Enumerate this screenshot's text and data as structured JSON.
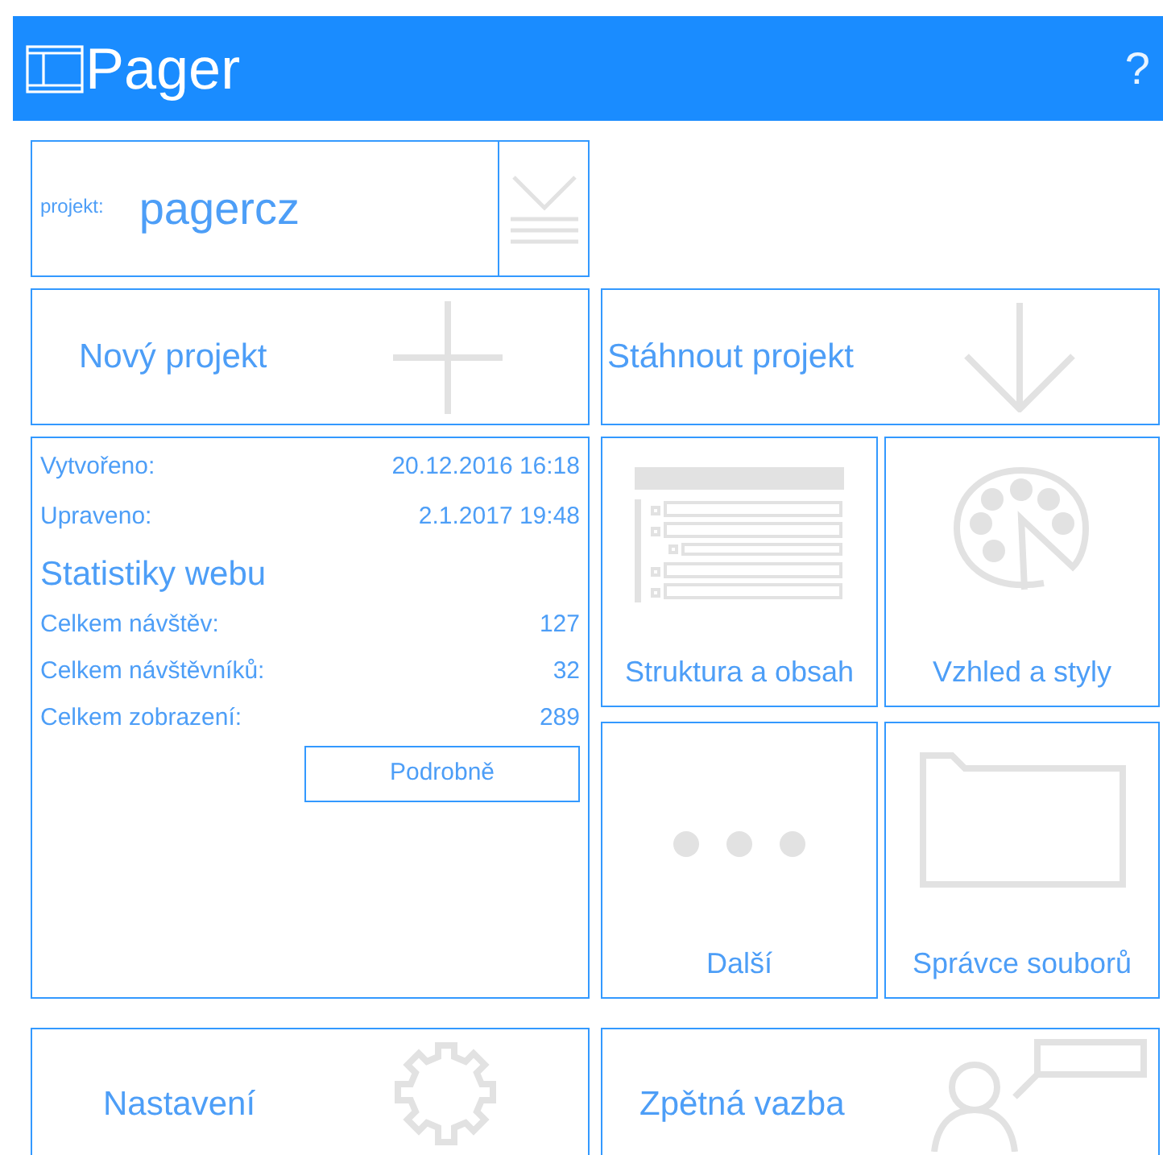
{
  "header": {
    "title": "Pager",
    "help": "?"
  },
  "project": {
    "label": "projekt:",
    "name": "pagercz"
  },
  "actions": [
    {
      "label": "Nový projekt",
      "kind": "plus"
    },
    {
      "label": "Stáhnout projekt",
      "kind": "download"
    }
  ],
  "info": {
    "rows": [
      {
        "label": "Vytvořeno:",
        "value": "20.12.2016 16:18"
      },
      {
        "label": "Upraveno:",
        "value": "2.1.2017 19:48"
      }
    ],
    "stats_title": "Statistiky webu",
    "stats": [
      {
        "label": "Celkem návštěv:",
        "value": "127"
      },
      {
        "label": "Celkem návštěvníků:",
        "value": "32"
      },
      {
        "label": "Celkem zobrazení:",
        "value": "289"
      }
    ],
    "button": "Podrobně"
  },
  "tiles": [
    {
      "label": "Struktura a obsah",
      "kind": "structure"
    },
    {
      "label": "Vzhled a styly",
      "kind": "palette"
    },
    {
      "label": "Další",
      "kind": "more"
    },
    {
      "label": "Správce souborů",
      "kind": "folder"
    }
  ],
  "bottom": [
    {
      "label": "Nastavení",
      "kind": "gear"
    },
    {
      "label": "Zpětná vazba",
      "kind": "feedback"
    }
  ]
}
